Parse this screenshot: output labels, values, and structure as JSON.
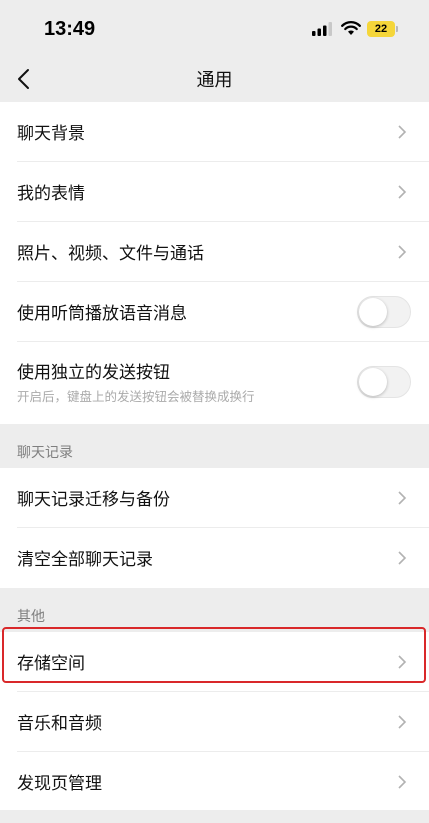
{
  "status_bar": {
    "time": "13:49",
    "battery": "22"
  },
  "nav": {
    "title": "通用"
  },
  "rows_top": [
    {
      "label": "聊天背景",
      "type": "chevron"
    },
    {
      "label": "我的表情",
      "type": "chevron"
    },
    {
      "label": "照片、视频、文件与通话",
      "type": "chevron"
    },
    {
      "label": "使用听筒播放语音消息",
      "type": "toggle",
      "on": false
    },
    {
      "label": "使用独立的发送按钮",
      "sublabel": "开启后，键盘上的发送按钮会被替换成换行",
      "type": "toggle",
      "on": false
    }
  ],
  "section_chat": {
    "title": "聊天记录",
    "rows": [
      {
        "label": "聊天记录迁移与备份"
      },
      {
        "label": "清空全部聊天记录"
      }
    ]
  },
  "section_other": {
    "title": "其他",
    "rows": [
      {
        "label": "存储空间",
        "highlighted": true
      },
      {
        "label": "音乐和音频"
      },
      {
        "label": "发现页管理"
      }
    ]
  },
  "colors": {
    "background": "#ededed",
    "row": "#ffffff",
    "highlight": "#d9282a",
    "section_text": "#7f7f7f",
    "battery": "#f5d63a"
  },
  "icons": [
    "back-arrow-icon",
    "chevron-right-icon",
    "signal-icon",
    "wifi-icon",
    "battery-icon"
  ]
}
